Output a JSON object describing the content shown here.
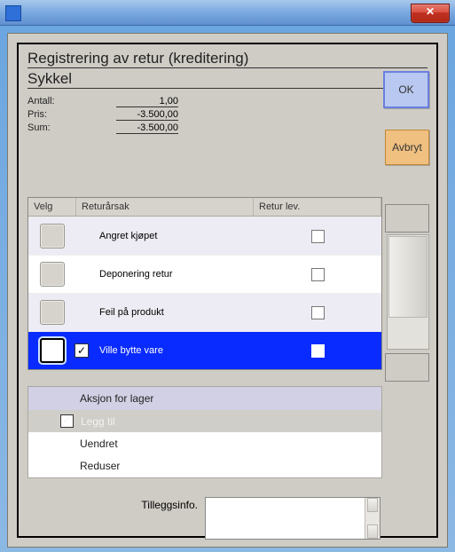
{
  "dialog": {
    "title": "Registrering av retur (kreditering)",
    "subtitle": "Sykkel"
  },
  "summary": {
    "qty_label": "Antall:",
    "qty_value": "1,00",
    "price_label": "Pris:",
    "price_value": "-3.500,00",
    "sum_label": "Sum:",
    "sum_value": "-3.500,00"
  },
  "buttons": {
    "ok": "OK",
    "cancel": "Avbryt"
  },
  "grid": {
    "headers": {
      "select": "Velg",
      "reason": "Returårsak",
      "delivery": "Retur lev."
    },
    "rows": [
      {
        "reason": "Angret kjøpet",
        "checked": false,
        "selected": false
      },
      {
        "reason": "Deponering retur",
        "checked": false,
        "selected": false
      },
      {
        "reason": "Feil på produkt",
        "checked": false,
        "selected": false
      },
      {
        "reason": "Ville bytte vare",
        "checked": true,
        "selected": true
      }
    ]
  },
  "action": {
    "header": "Aksjon for lager",
    "options": [
      {
        "label": "Legg til",
        "checked": true,
        "selected": true
      },
      {
        "label": "Uendret",
        "checked": false,
        "selected": false
      },
      {
        "label": "Reduser",
        "checked": false,
        "selected": false
      }
    ]
  },
  "extra": {
    "label": "Tilleggsinfo."
  }
}
